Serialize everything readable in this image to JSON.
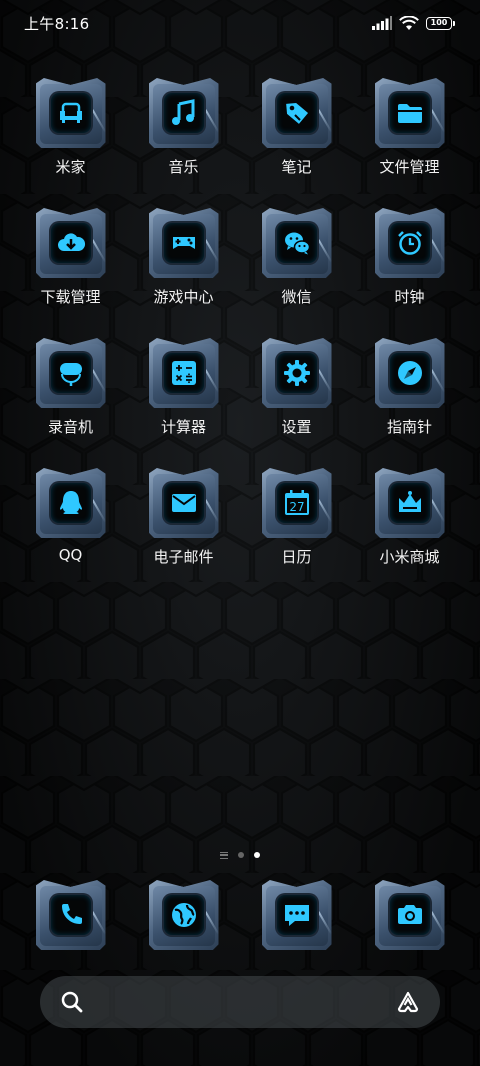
{
  "status_bar": {
    "time": "上午8:16",
    "battery": "100"
  },
  "apps": [
    {
      "label": "米家",
      "icon": "sofa-icon"
    },
    {
      "label": "音乐",
      "icon": "music-note-icon"
    },
    {
      "label": "笔记",
      "icon": "tag-icon"
    },
    {
      "label": "文件管理",
      "icon": "folder-icon"
    },
    {
      "label": "下载管理",
      "icon": "cloud-download-icon"
    },
    {
      "label": "游戏中心",
      "icon": "gamepad-icon"
    },
    {
      "label": "微信",
      "icon": "wechat-icon"
    },
    {
      "label": "时钟",
      "icon": "alarm-clock-icon"
    },
    {
      "label": "录音机",
      "icon": "microphone-icon"
    },
    {
      "label": "计算器",
      "icon": "calculator-icon"
    },
    {
      "label": "设置",
      "icon": "gear-icon"
    },
    {
      "label": "指南针",
      "icon": "compass-icon"
    },
    {
      "label": "QQ",
      "icon": "penguin-icon"
    },
    {
      "label": "电子邮件",
      "icon": "envelope-icon"
    },
    {
      "label": "日历",
      "icon": "calendar-icon",
      "day": "27"
    },
    {
      "label": "小米商城",
      "icon": "crown-icon"
    }
  ],
  "dock": [
    {
      "icon": "phone-icon"
    },
    {
      "icon": "globe-icon"
    },
    {
      "icon": "message-icon"
    },
    {
      "icon": "camera-icon"
    }
  ],
  "pages": {
    "count": 2,
    "active": 2
  },
  "colors": {
    "accent": "#2fc8ff",
    "tile_frame": "#5a7390",
    "background": "#0a0b0c"
  }
}
